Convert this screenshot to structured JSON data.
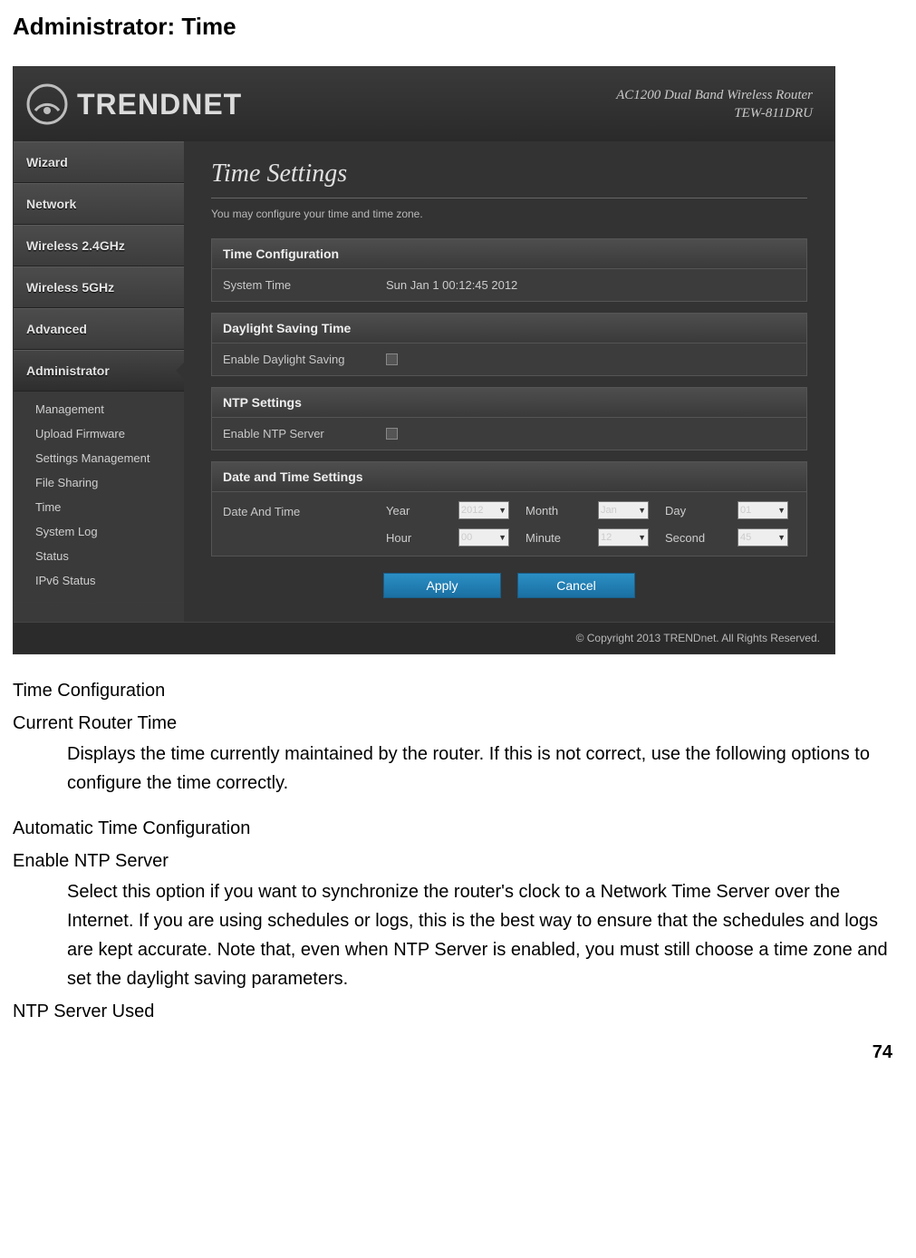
{
  "page": {
    "title": "Administrator: Time",
    "number": "74"
  },
  "router": {
    "brand": "TRENDNET",
    "device_line1": "AC1200 Dual Band Wireless Router",
    "device_line2": "TEW-811DRU",
    "footer": "© Copyright 2013 TRENDnet. All Rights Reserved.",
    "nav": {
      "items": [
        "Wizard",
        "Network",
        "Wireless 2.4GHz",
        "Wireless 5GHz",
        "Advanced",
        "Administrator"
      ],
      "sub": [
        "Management",
        "Upload Firmware",
        "Settings Management",
        "File Sharing",
        "Time",
        "System Log",
        "Status",
        "IPv6 Status"
      ]
    },
    "content": {
      "title": "Time Settings",
      "subtitle": "You may configure your time and time zone.",
      "time_config": {
        "header": "Time Configuration",
        "label": "System Time",
        "value": "Sun Jan 1 00:12:45 2012"
      },
      "dst": {
        "header": "Daylight Saving Time",
        "label": "Enable Daylight Saving"
      },
      "ntp": {
        "header": "NTP Settings",
        "label": "Enable NTP Server"
      },
      "datetime": {
        "header": "Date and Time Settings",
        "label": "Date And Time",
        "year_lbl": "Year",
        "year_val": "2012",
        "month_lbl": "Month",
        "month_val": "Jan",
        "day_lbl": "Day",
        "day_val": "01",
        "hour_lbl": "Hour",
        "hour_val": "00",
        "minute_lbl": "Minute",
        "minute_val": "12",
        "second_lbl": "Second",
        "second_val": "45"
      },
      "buttons": {
        "apply": "Apply",
        "cancel": "Cancel"
      }
    }
  },
  "doc": {
    "s1_title": "Time Configuration",
    "s1_item_title": "Current Router Time",
    "s1_item_body": "Displays the time currently maintained by the router. If this is not correct, use the following options to configure the time correctly.",
    "s2_title": "Automatic Time Configuration",
    "s2_item_title": "Enable NTP Server",
    "s2_item_body": "Select this option if you want to synchronize the router's clock to a Network Time Server over the Internet. If you are using schedules or logs, this is the best way to ensure that the schedules and logs are kept accurate. Note that, even when NTP Server is enabled, you must still choose a time zone and set the daylight saving parameters.",
    "s2_item2_title": "NTP Server Used"
  }
}
